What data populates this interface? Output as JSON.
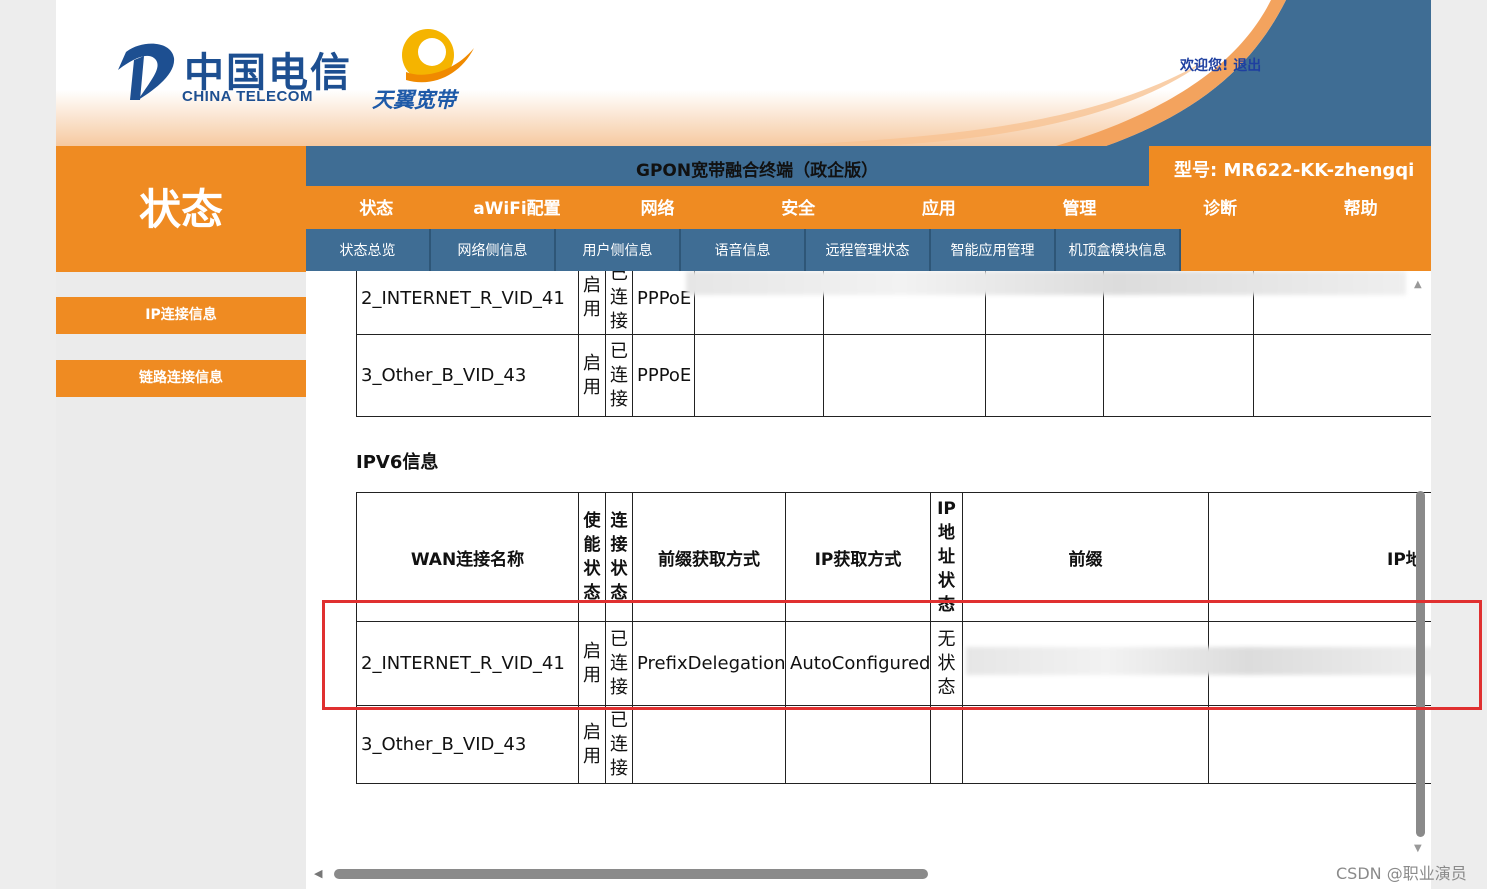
{
  "header": {
    "logo_cn": "中国电信",
    "logo_en": "CHINA TELECOM",
    "brand2": "天翼宽带",
    "welcome": "欢迎您!",
    "logout": "退出"
  },
  "side": {
    "section_title": "状态",
    "items": [
      "IP连接信息",
      "链路连接信息"
    ]
  },
  "title_bar": {
    "device_title": "GPON宽带融合终端（政企版）",
    "model_label": "型号: ",
    "model_value": "MR622-KK-zhengqi"
  },
  "nav": [
    "状态",
    "aWiFi配置",
    "网络",
    "安全",
    "应用",
    "管理",
    "诊断",
    "帮助"
  ],
  "subnav": [
    "状态总览",
    "网络侧信息",
    "用户侧信息",
    "语音信息",
    "远程管理状态",
    "智能应用管理",
    "机顶盒模块信息"
  ],
  "ipv4_table": {
    "rows": [
      {
        "name": "2_INTERNET_R_VID_41",
        "enable": "启用",
        "status": "已连接",
        "protocol": "PPPoE"
      },
      {
        "name": "3_Other_B_VID_43",
        "enable": "启用",
        "status": "已连接",
        "protocol": "PPPoE"
      }
    ]
  },
  "ipv6": {
    "title": "IPV6信息",
    "headers": [
      "WAN连接名称",
      "使能状态",
      "连接状态",
      "前缀获取方式",
      "IP获取方式",
      "IP地址状态",
      "前缀",
      "IP地"
    ],
    "rows": [
      {
        "name": "2_INTERNET_R_VID_41",
        "enable": "启用",
        "status": "已连接",
        "prefix_mode": "PrefixDelegation",
        "ip_mode": "AutoConfigured",
        "ip_status": "无状态",
        "prefix": "",
        "ip": ""
      },
      {
        "name": "3_Other_B_VID_43",
        "enable": "启用",
        "status": "已连接",
        "prefix_mode": "",
        "ip_mode": "",
        "ip_status": "",
        "prefix": "",
        "ip": ""
      }
    ]
  },
  "watermark": "CSDN @职业演员",
  "colors": {
    "orange": "#ef8b22",
    "blue": "#3f6d94",
    "highlight": "#e03030"
  }
}
